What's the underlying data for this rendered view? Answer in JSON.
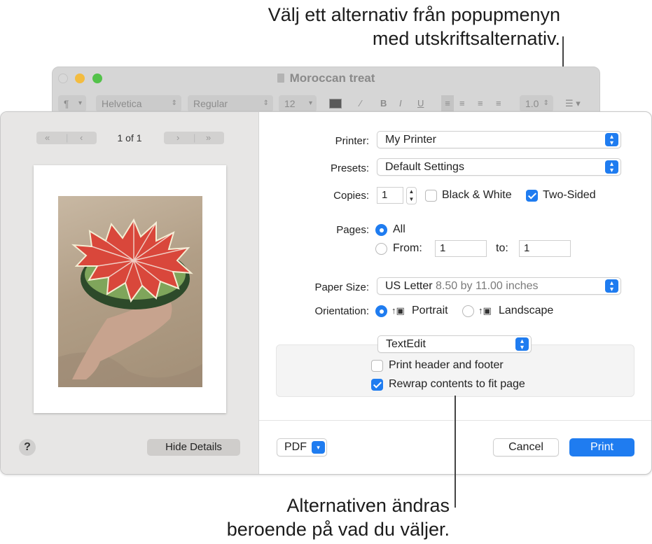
{
  "callouts": {
    "top_line1": "Välj ett alternativ från popupmenyn",
    "top_line2": "med utskriftsalternativ.",
    "bottom_line1": "Alternativen ändras",
    "bottom_line2": "beroende på vad du väljer."
  },
  "background_window": {
    "title": "Moroccan treat",
    "toolbar": {
      "paragraph": "¶",
      "font": "Helvetica",
      "style": "Regular",
      "size": "12",
      "bold": "B",
      "italic": "I",
      "underline": "U",
      "line_spacing": "1.0"
    }
  },
  "preview": {
    "page_indicator": "1 of 1",
    "first_glyph": "«",
    "prev_glyph": "‹",
    "next_glyph": "›",
    "last_glyph": "»"
  },
  "left_buttons": {
    "help": "?",
    "hide_details": "Hide Details"
  },
  "form": {
    "printer_label": "Printer:",
    "printer_value": "My Printer",
    "presets_label": "Presets:",
    "presets_value": "Default Settings",
    "copies_label": "Copies:",
    "copies_value": "1",
    "black_white_label": "Black & White",
    "black_white_checked": false,
    "two_sided_label": "Two-Sided",
    "two_sided_checked": true,
    "pages_label": "Pages:",
    "pages_all_label": "All",
    "pages_from_label": "From:",
    "pages_from_value": "1",
    "pages_to_label": "to:",
    "pages_to_value": "1",
    "paper_size_label": "Paper Size:",
    "paper_size_value": "US Letter",
    "paper_size_detail": "8.50 by 11.00 inches",
    "orientation_label": "Orientation:",
    "portrait_label": "Portrait",
    "landscape_label": "Landscape",
    "app_options_value": "TextEdit",
    "print_header_footer_label": "Print header and footer",
    "print_header_footer_checked": false,
    "rewrap_label": "Rewrap contents to fit page",
    "rewrap_checked": true
  },
  "footer": {
    "pdf_label": "PDF",
    "cancel_label": "Cancel",
    "print_label": "Print"
  },
  "colors": {
    "accent": "#1f7cf0",
    "traffic_yellow": "#f3bc40",
    "traffic_green": "#53c24a"
  }
}
